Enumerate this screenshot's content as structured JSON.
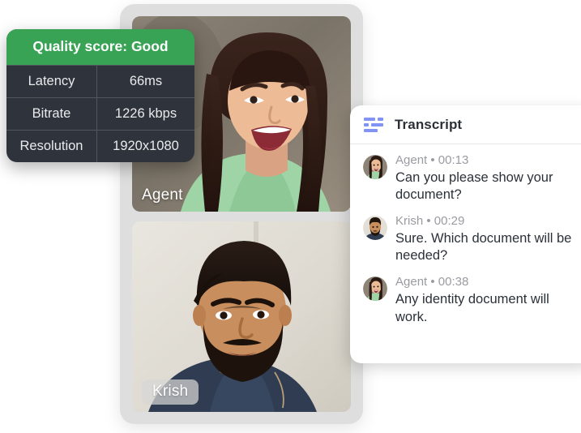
{
  "quality_card": {
    "header_label": "Quality score: Good",
    "header_color": "#38a355",
    "background_color": "#2f343c",
    "rows": [
      {
        "label": "Latency",
        "value": "66ms"
      },
      {
        "label": "Bitrate",
        "value": "1226 kbps"
      },
      {
        "label": "Resolution",
        "value": "1920x1080"
      }
    ]
  },
  "call": {
    "tiles": [
      {
        "name": "Agent",
        "position": "top"
      },
      {
        "name": "Krish",
        "position": "bottom"
      }
    ]
  },
  "transcript": {
    "icon": "transcript-lines-icon",
    "icon_color": "#8193f4",
    "title": "Transcript",
    "messages": [
      {
        "speaker": "Agent",
        "separator": "•",
        "time": "00:13",
        "meta": "Agent • 00:13",
        "text": "Can you please show your document?",
        "avatar": "agent-avatar"
      },
      {
        "speaker": "Krish",
        "separator": "•",
        "time": "00:29",
        "meta": "Krish • 00:29",
        "text": "Sure. Which document will be needed?",
        "avatar": "krish-avatar"
      },
      {
        "speaker": "Agent",
        "separator": "•",
        "time": "00:38",
        "meta": "Agent • 00:38",
        "text": "Any identity document will work.",
        "avatar": "agent-avatar"
      }
    ]
  }
}
